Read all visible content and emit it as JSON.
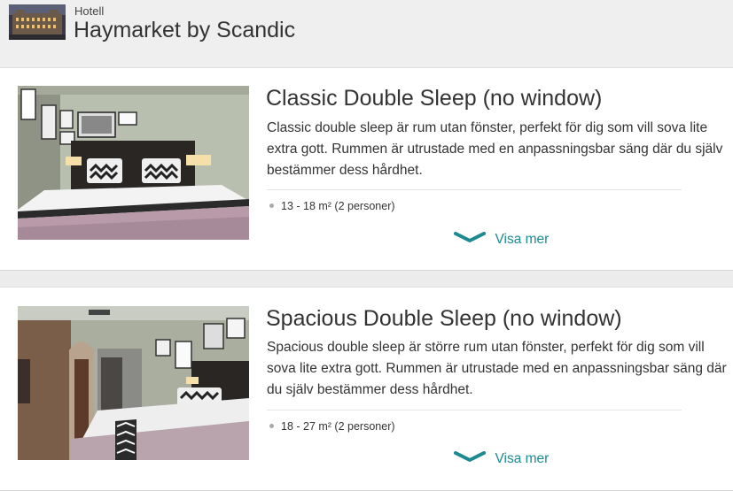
{
  "header": {
    "kicker": "Hotell",
    "title": "Haymarket by Scandic"
  },
  "rooms": [
    {
      "title": "Classic Double Sleep (no window)",
      "description": "Classic double sleep är rum utan fönster, perfekt för dig som vill sova lite extra gott. Rummen är utrustade med en anpassningsbar säng där du själv bestämmer dess hårdhet.",
      "size": "13 - 18 m² (2 personer)",
      "show_more": "Visa mer"
    },
    {
      "title": "Spacious Double Sleep (no window)",
      "description": "Spacious double sleep är större rum utan fönster, perfekt för dig som vill sova lite extra gott. Rummen är utrustade med en anpassningsbar säng där du själv bestämmer dess hårdhet.",
      "size": "18 - 27 m² (2 personer)",
      "show_more": "Visa mer"
    }
  ],
  "colors": {
    "accent": "#1b8a93",
    "page_background": "#ececec",
    "card_background": "#ffffff"
  },
  "icons": {
    "show_more": "chevron-down-icon"
  }
}
